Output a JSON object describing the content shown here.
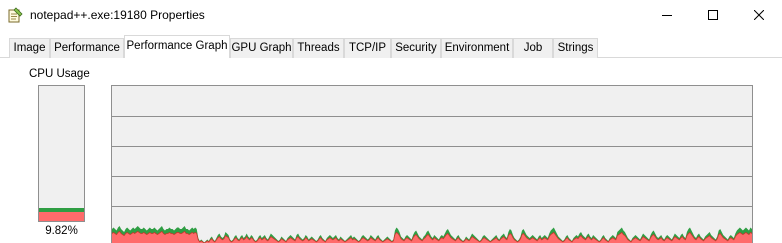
{
  "window": {
    "title": "notepad++.exe:19180 Properties",
    "icon": "notepad-app-icon",
    "controls": {
      "minimize_icon": "minimize-icon",
      "maximize_icon": "maximize-icon",
      "close_icon": "close-icon"
    }
  },
  "tabs": [
    {
      "label": "Image",
      "active": false
    },
    {
      "label": "Performance",
      "active": false
    },
    {
      "label": "Performance Graph",
      "active": true
    },
    {
      "label": "GPU Graph",
      "active": false
    },
    {
      "label": "Threads",
      "active": false
    },
    {
      "label": "TCP/IP",
      "active": false
    },
    {
      "label": "Security",
      "active": false
    },
    {
      "label": "Environment",
      "active": false
    },
    {
      "label": "Job",
      "active": false
    },
    {
      "label": "Strings",
      "active": false
    }
  ],
  "cpu": {
    "label": "CPU Usage",
    "percent_text": "9.82%",
    "total_fraction": 0.0982,
    "kernel_fraction": 0.07
  },
  "colors": {
    "total": "#2f9e44",
    "kernel": "#ff6b6b",
    "background": "#f0f0f0",
    "grid": "#8f8f8f"
  },
  "graph": {
    "total_history": [
      0.1,
      0.11,
      0.1,
      0.09,
      0.11,
      0.12,
      0.1,
      0.09,
      0.08,
      0.1,
      0.11,
      0.1,
      0.09,
      0.1,
      0.11,
      0.1,
      0.11,
      0.12,
      0.11,
      0.1,
      0.1,
      0.11,
      0.1,
      0.09,
      0.1,
      0.11,
      0.1,
      0.1,
      0.11,
      0.1,
      0.09,
      0.1,
      0.11,
      0.12,
      0.1,
      0.09,
      0.1,
      0.1,
      0.11,
      0.1,
      0.1,
      0.09,
      0.1,
      0.11,
      0.11,
      0.1,
      0.1,
      0.11,
      0.12,
      0.1,
      0.1,
      0.09,
      0.1,
      0.11,
      0.1,
      0.11,
      0.1,
      0.04,
      0.02,
      0.03,
      0.02,
      0.01,
      0.02,
      0.03,
      0.02,
      0.04,
      0.05,
      0.03,
      0.02,
      0.04,
      0.06,
      0.07,
      0.05,
      0.04,
      0.05,
      0.08,
      0.07,
      0.06,
      0.03,
      0.02,
      0.03,
      0.05,
      0.06,
      0.04,
      0.03,
      0.05,
      0.06,
      0.04,
      0.05,
      0.07,
      0.05,
      0.04,
      0.06,
      0.05,
      0.03,
      0.02,
      0.03,
      0.05,
      0.06,
      0.04,
      0.05,
      0.06,
      0.04,
      0.03,
      0.05,
      0.07,
      0.06,
      0.05,
      0.04,
      0.03,
      0.02,
      0.03,
      0.05,
      0.04,
      0.03,
      0.02,
      0.04,
      0.05,
      0.06,
      0.05,
      0.04,
      0.03,
      0.06,
      0.07,
      0.05,
      0.04,
      0.03,
      0.04,
      0.06,
      0.05,
      0.03,
      0.04,
      0.05,
      0.04,
      0.03,
      0.02,
      0.03,
      0.05,
      0.06,
      0.04,
      0.03,
      0.02,
      0.04,
      0.05,
      0.06,
      0.05,
      0.04,
      0.05,
      0.06,
      0.04,
      0.03,
      0.05,
      0.04,
      0.03,
      0.02,
      0.03,
      0.04,
      0.05,
      0.06,
      0.04,
      0.05,
      0.04,
      0.03,
      0.02,
      0.03,
      0.05,
      0.06,
      0.05,
      0.04,
      0.03,
      0.04,
      0.06,
      0.05,
      0.04,
      0.03,
      0.05,
      0.06,
      0.04,
      0.03,
      0.02,
      0.03,
      0.04,
      0.05,
      0.04,
      0.03,
      0.02,
      0.03,
      0.09,
      0.11,
      0.1,
      0.08,
      0.05,
      0.04,
      0.03,
      0.05,
      0.06,
      0.05,
      0.04,
      0.03,
      0.06,
      0.08,
      0.09,
      0.07,
      0.05,
      0.04,
      0.03,
      0.05,
      0.06,
      0.08,
      0.09,
      0.07,
      0.05,
      0.04,
      0.06,
      0.05,
      0.04,
      0.03,
      0.05,
      0.06,
      0.05,
      0.07,
      0.09,
      0.1,
      0.08,
      0.06,
      0.05,
      0.04,
      0.03,
      0.05,
      0.06,
      0.04,
      0.03,
      0.02,
      0.03,
      0.05,
      0.04,
      0.03,
      0.05,
      0.07,
      0.06,
      0.05,
      0.04,
      0.03,
      0.02,
      0.03,
      0.05,
      0.06,
      0.05,
      0.04,
      0.03,
      0.02,
      0.03,
      0.04,
      0.05,
      0.06,
      0.04,
      0.03,
      0.05,
      0.06,
      0.07,
      0.05,
      0.04,
      0.08,
      0.1,
      0.09,
      0.06,
      0.04,
      0.03,
      0.02,
      0.03,
      0.05,
      0.09,
      0.1,
      0.08,
      0.06,
      0.05,
      0.04,
      0.05,
      0.06,
      0.05,
      0.04,
      0.03,
      0.05,
      0.06,
      0.04,
      0.05,
      0.06,
      0.05,
      0.04,
      0.07,
      0.09,
      0.1,
      0.11,
      0.09,
      0.07,
      0.05,
      0.04,
      0.03,
      0.02,
      0.03,
      0.05,
      0.06,
      0.04,
      0.03,
      0.02,
      0.04,
      0.05,
      0.06,
      0.05,
      0.07,
      0.08,
      0.06,
      0.05,
      0.04,
      0.06,
      0.07,
      0.05,
      0.04,
      0.06,
      0.05,
      0.04,
      0.03,
      0.02,
      0.03,
      0.05,
      0.06,
      0.04,
      0.03,
      0.02,
      0.04,
      0.05,
      0.06,
      0.05,
      0.04,
      0.08,
      0.09,
      0.1,
      0.11,
      0.09,
      0.08,
      0.06,
      0.04,
      0.03,
      0.02,
      0.04,
      0.05,
      0.06,
      0.05,
      0.04,
      0.03,
      0.05,
      0.07,
      0.06,
      0.05,
      0.04,
      0.03,
      0.06,
      0.08,
      0.09,
      0.07,
      0.05,
      0.04,
      0.05,
      0.06,
      0.04,
      0.03,
      0.05,
      0.06,
      0.05,
      0.04,
      0.03,
      0.05,
      0.07,
      0.06,
      0.05,
      0.04,
      0.06,
      0.07,
      0.05,
      0.04,
      0.08,
      0.1,
      0.11,
      0.09,
      0.07,
      0.05,
      0.04,
      0.06,
      0.07,
      0.05,
      0.04,
      0.03,
      0.05,
      0.06,
      0.07,
      0.08,
      0.06,
      0.05,
      0.04,
      0.03,
      0.05,
      0.09,
      0.1,
      0.08,
      0.06,
      0.05,
      0.04,
      0.03,
      0.05,
      0.06,
      0.05,
      0.04,
      0.07,
      0.09,
      0.1,
      0.11,
      0.1,
      0.09,
      0.1,
      0.11,
      0.1,
      0.09,
      0.11,
      0.1
    ],
    "kernel_ratio": 0.7
  }
}
